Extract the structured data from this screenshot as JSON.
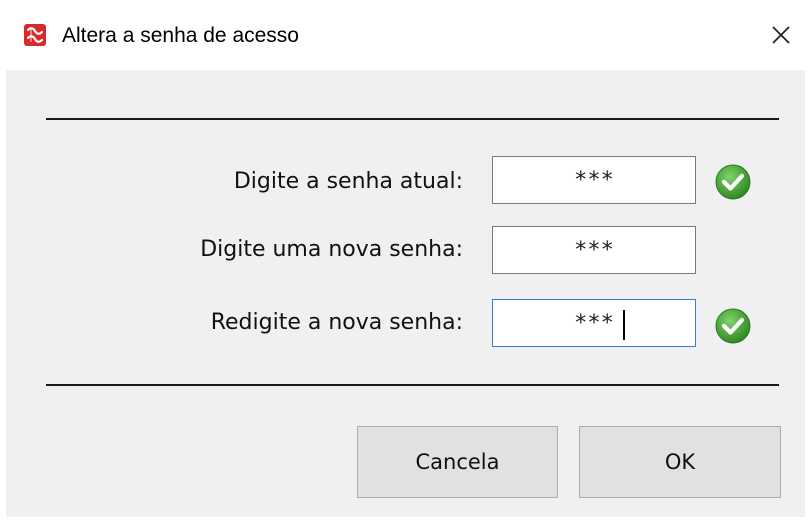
{
  "window": {
    "title": "Altera a senha de acesso",
    "app_icon": "app-logo-icon",
    "close_icon": "close-icon"
  },
  "form": {
    "current_password": {
      "label": "Digite a senha atual:",
      "value": "***",
      "status_icon": "check-icon",
      "valid": true
    },
    "new_password": {
      "label": "Digite uma nova senha:",
      "value": "***"
    },
    "confirm_password": {
      "label": "Redigite a nova senha:",
      "value": "***",
      "status_icon": "check-icon",
      "valid": true,
      "focused": true
    }
  },
  "buttons": {
    "cancel_label": "Cancela",
    "ok_label": "OK"
  },
  "colors": {
    "client_background": "#f0f0f0",
    "app_icon_red": "#d92a2a",
    "check_green": "#3c9a2c",
    "focus_border": "#3a7ad0",
    "button_face": "#e1e1e1"
  }
}
